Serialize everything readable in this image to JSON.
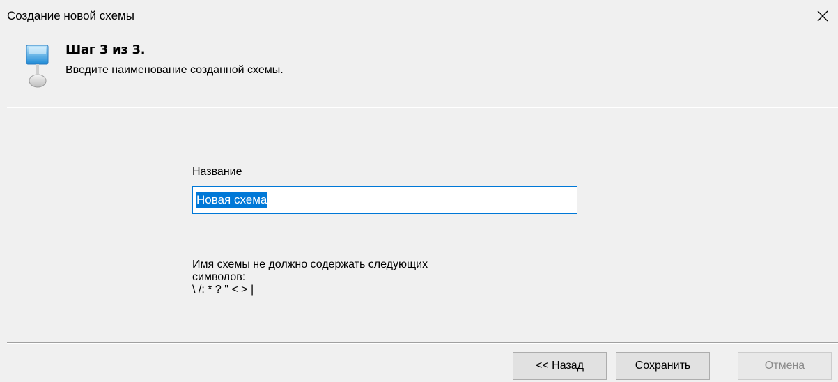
{
  "window": {
    "title": "Создание новой схемы",
    "close_icon": "close-icon"
  },
  "header": {
    "icon": "monitor-wizard-icon",
    "step_title": "Шаг 3 из 3.",
    "step_description": "Введите наименование созданной схемы."
  },
  "form": {
    "name_label": "Название",
    "name_value": "Новая схема",
    "hint_line1": "Имя схемы не должно содержать следующих",
    "hint_line2": "символов:",
    "hint_line3": "\\ /: * ? \" < > |"
  },
  "buttons": {
    "back": "<< Назад",
    "save": "Сохранить",
    "cancel": "Отмена"
  }
}
